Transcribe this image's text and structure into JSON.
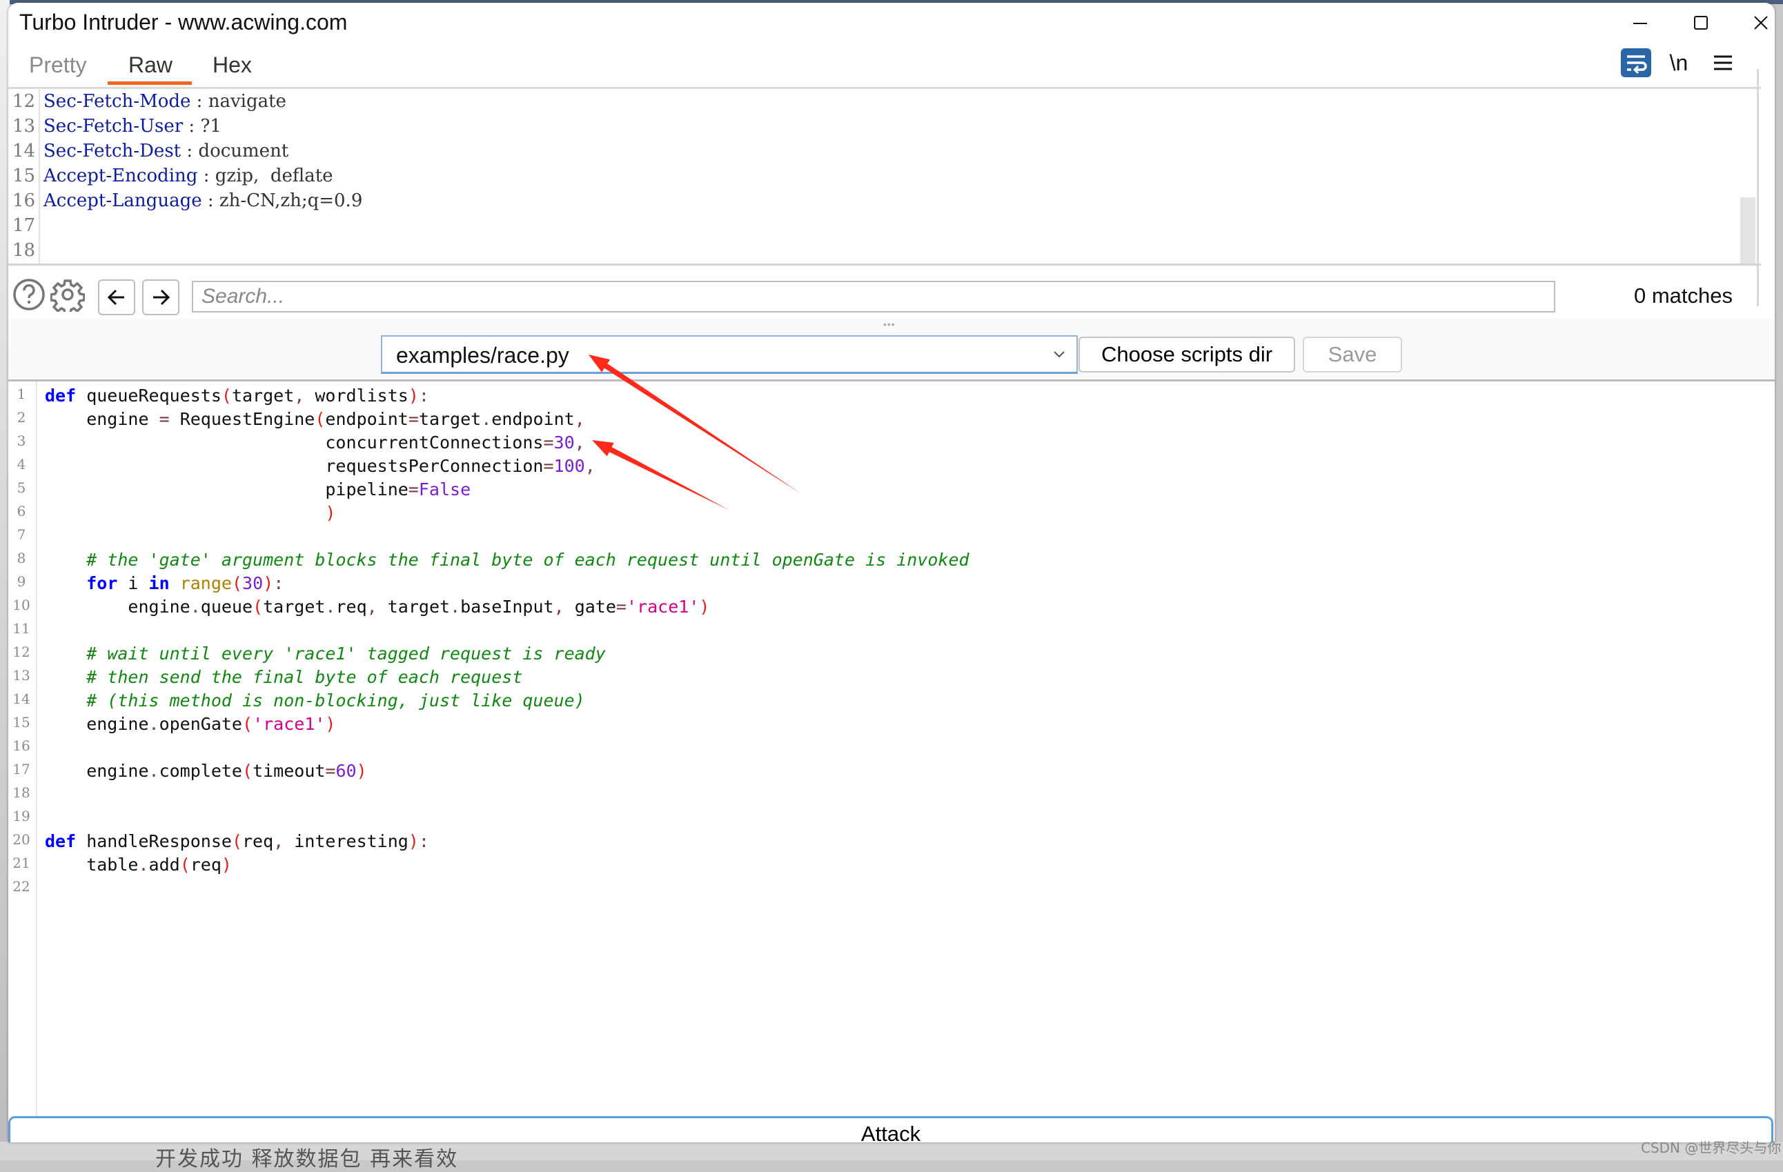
{
  "window": {
    "title": "Turbo Intruder - www.acwing.com",
    "controls": [
      "minimize",
      "maximize",
      "close"
    ]
  },
  "tabs": [
    {
      "label": "Pretty",
      "active": false
    },
    {
      "label": "Raw",
      "active": true
    },
    {
      "label": "Hex",
      "active": false
    }
  ],
  "toolbar_icons": [
    "wrap-lines-icon",
    "newline-toggle-icon",
    "menu-icon"
  ],
  "toolbar_newline_label": "\\n",
  "accent_color": "#f26522",
  "request_lines": [
    {
      "num": "12",
      "key": "Sec-Fetch-Mode",
      "sep": " : ",
      "value": "navigate"
    },
    {
      "num": "13",
      "key": "Sec-Fetch-User",
      "sep": " : ",
      "value": "?1"
    },
    {
      "num": "14",
      "key": "Sec-Fetch-Dest",
      "sep": " : ",
      "value": "document"
    },
    {
      "num": "15",
      "key": "Accept-Encoding",
      "sep": " : ",
      "value": "gzip,  deflate"
    },
    {
      "num": "16",
      "key": "Accept-Language",
      "sep": " : ",
      "value": "zh-CN,zh;q=0.9"
    },
    {
      "num": "17",
      "key": "",
      "sep": "",
      "value": ""
    },
    {
      "num": "18",
      "key": "",
      "sep": "",
      "value": ""
    }
  ],
  "search": {
    "placeholder": "Search...",
    "value": "",
    "matches": "0 matches"
  },
  "script_bar": {
    "selected_script": "examples/race.py",
    "choose_dir_label": "Choose scripts dir",
    "save_label": "Save"
  },
  "code_lines": [
    {
      "num": "1",
      "tokens": [
        [
          "kw",
          "def"
        ],
        [
          "tx",
          " queueRequests"
        ],
        [
          "pn",
          "("
        ],
        [
          "tx",
          "target"
        ],
        [
          "op",
          ","
        ],
        [
          "tx",
          " wordlists"
        ],
        [
          "pn",
          ")"
        ],
        [
          "op",
          ":"
        ]
      ]
    },
    {
      "num": "2",
      "tokens": [
        [
          "tx",
          "    engine "
        ],
        [
          "op",
          "="
        ],
        [
          "tx",
          " RequestEngine"
        ],
        [
          "pn",
          "("
        ],
        [
          "tx",
          "endpoint"
        ],
        [
          "op",
          "="
        ],
        [
          "tx",
          "target"
        ],
        [
          "op",
          "."
        ],
        [
          "tx",
          "endpoint"
        ],
        [
          "op",
          ","
        ]
      ]
    },
    {
      "num": "3",
      "tokens": [
        [
          "tx",
          "                           concurrentConnections"
        ],
        [
          "op",
          "="
        ],
        [
          "nm",
          "30"
        ],
        [
          "op",
          ","
        ]
      ]
    },
    {
      "num": "4",
      "tokens": [
        [
          "tx",
          "                           requestsPerConnection"
        ],
        [
          "op",
          "="
        ],
        [
          "nm",
          "100"
        ],
        [
          "op",
          ","
        ]
      ]
    },
    {
      "num": "5",
      "tokens": [
        [
          "tx",
          "                           pipeline"
        ],
        [
          "op",
          "="
        ],
        [
          "nm",
          "False"
        ]
      ]
    },
    {
      "num": "6",
      "tokens": [
        [
          "tx",
          "                           "
        ],
        [
          "pn",
          ")"
        ]
      ]
    },
    {
      "num": "7",
      "tokens": []
    },
    {
      "num": "8",
      "tokens": [
        [
          "tx",
          "    "
        ],
        [
          "cm",
          "# the 'gate' argument blocks the final byte of each request until openGate is invoked"
        ]
      ]
    },
    {
      "num": "9",
      "tokens": [
        [
          "tx",
          "    "
        ],
        [
          "kw",
          "for"
        ],
        [
          "tx",
          " i "
        ],
        [
          "kw",
          "in"
        ],
        [
          "tx",
          " "
        ],
        [
          "bi",
          "range"
        ],
        [
          "pn",
          "("
        ],
        [
          "nm",
          "30"
        ],
        [
          "pn",
          ")"
        ],
        [
          "op",
          ":"
        ]
      ]
    },
    {
      "num": "10",
      "tokens": [
        [
          "tx",
          "        engine"
        ],
        [
          "op",
          "."
        ],
        [
          "tx",
          "queue"
        ],
        [
          "pn",
          "("
        ],
        [
          "tx",
          "target"
        ],
        [
          "op",
          "."
        ],
        [
          "tx",
          "req"
        ],
        [
          "op",
          ","
        ],
        [
          "tx",
          " target"
        ],
        [
          "op",
          "."
        ],
        [
          "tx",
          "baseInput"
        ],
        [
          "op",
          ","
        ],
        [
          "tx",
          " gate"
        ],
        [
          "op",
          "="
        ],
        [
          "st",
          "'race1'"
        ],
        [
          "pn",
          ")"
        ]
      ]
    },
    {
      "num": "11",
      "tokens": []
    },
    {
      "num": "12",
      "tokens": [
        [
          "tx",
          "    "
        ],
        [
          "cm",
          "# wait until every 'race1' tagged request is ready"
        ]
      ]
    },
    {
      "num": "13",
      "tokens": [
        [
          "tx",
          "    "
        ],
        [
          "cm",
          "# then send the final byte of each request"
        ]
      ]
    },
    {
      "num": "14",
      "tokens": [
        [
          "tx",
          "    "
        ],
        [
          "cm",
          "# (this method is non-blocking, just like queue)"
        ]
      ]
    },
    {
      "num": "15",
      "tokens": [
        [
          "tx",
          "    engine"
        ],
        [
          "op",
          "."
        ],
        [
          "tx",
          "openGate"
        ],
        [
          "pn",
          "("
        ],
        [
          "st",
          "'race1'"
        ],
        [
          "pn",
          ")"
        ]
      ]
    },
    {
      "num": "16",
      "tokens": []
    },
    {
      "num": "17",
      "tokens": [
        [
          "tx",
          "    engine"
        ],
        [
          "op",
          "."
        ],
        [
          "tx",
          "complete"
        ],
        [
          "pn",
          "("
        ],
        [
          "tx",
          "timeout"
        ],
        [
          "op",
          "="
        ],
        [
          "nm",
          "60"
        ],
        [
          "pn",
          ")"
        ]
      ]
    },
    {
      "num": "18",
      "tokens": []
    },
    {
      "num": "19",
      "tokens": []
    },
    {
      "num": "20",
      "tokens": [
        [
          "kw",
          "def"
        ],
        [
          "tx",
          " handleResponse"
        ],
        [
          "pn",
          "("
        ],
        [
          "tx",
          "req"
        ],
        [
          "op",
          ","
        ],
        [
          "tx",
          " interesting"
        ],
        [
          "pn",
          ")"
        ],
        [
          "op",
          ":"
        ]
      ]
    },
    {
      "num": "21",
      "tokens": [
        [
          "tx",
          "    table"
        ],
        [
          "op",
          "."
        ],
        [
          "tx",
          "add"
        ],
        [
          "pn",
          "("
        ],
        [
          "tx",
          "req"
        ],
        [
          "pn",
          ")"
        ]
      ]
    },
    {
      "num": "22",
      "tokens": []
    }
  ],
  "attack_label": "Attack",
  "annotations": {
    "arrow_color": "#ff2a1a",
    "arrows": [
      {
        "points_to": "script-select"
      },
      {
        "points_to": "concurrentConnections=30"
      }
    ]
  },
  "background": {
    "bottom_text": "开发成功 释放数据包 再来看效",
    "watermark": "CSDN @世界尽头与你"
  }
}
